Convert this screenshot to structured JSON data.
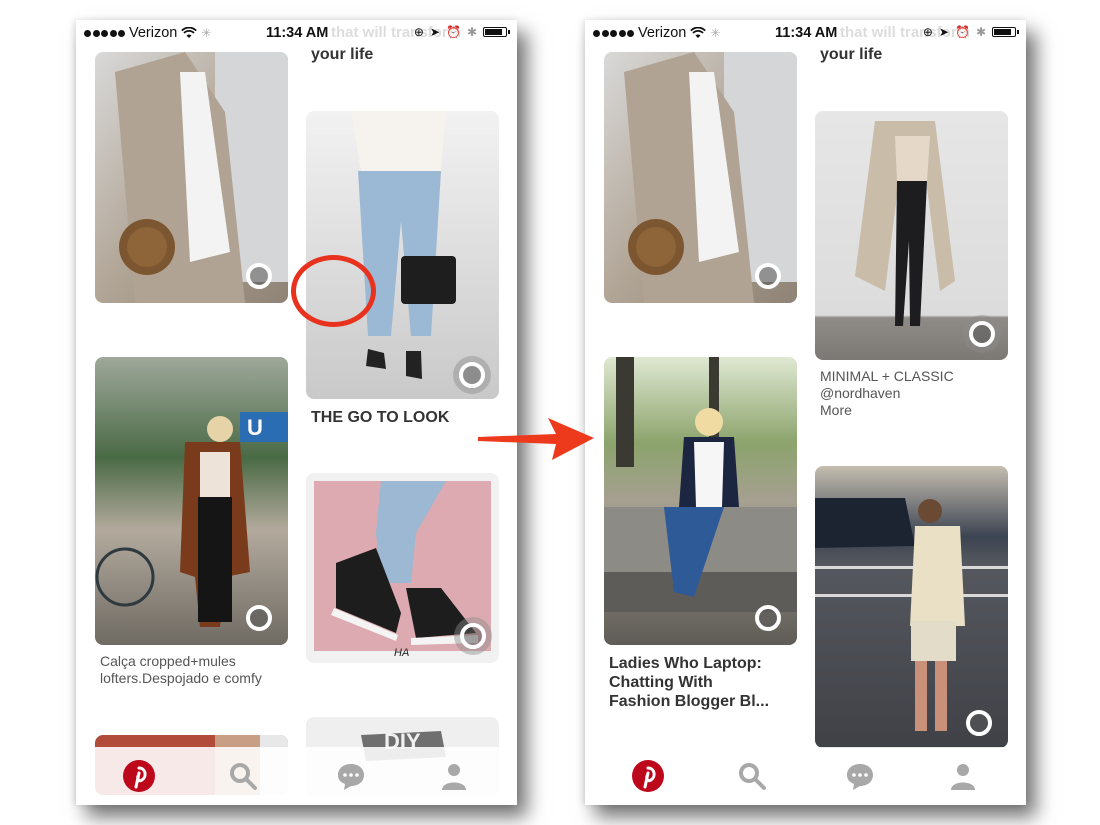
{
  "annotation": {
    "arrow_color": "#ee3a1c",
    "circle_color": "#e8321e",
    "arrow_direction": "right"
  },
  "colors": {
    "pinterest_red": "#bd081c",
    "nav_gray": "#a8a8a8",
    "text_dark": "#333333",
    "text_caption": "#555555"
  },
  "screens": [
    {
      "status_bar": {
        "carrier": "Verizon",
        "signal_dots": 5,
        "time": "11:34 AM",
        "ghost_text": "that will transform"
      },
      "heading_fragment": "your life",
      "pins": [
        {
          "id": "pin-blazer-bag",
          "caption": "",
          "title": ""
        },
        {
          "id": "pin-jeans-slides",
          "caption": "",
          "title": "THE GO TO LOOK"
        },
        {
          "id": "pin-subway-coat",
          "caption": "Calça cropped+mules lofters.Despojado e comfy",
          "title": ""
        },
        {
          "id": "pin-sneakers-illustration",
          "caption": "",
          "title": "",
          "signature": "HA"
        },
        {
          "id": "pin-red-partial",
          "caption": "",
          "title": ""
        },
        {
          "id": "pin-diy-partial",
          "caption": "",
          "title": "",
          "badge": "DIY"
        }
      ],
      "nav": [
        {
          "icon": "pinterest-logo-icon",
          "label": "Home"
        },
        {
          "icon": "search-icon",
          "label": "Search"
        },
        {
          "icon": "chat-bubble-icon",
          "label": "Notifications"
        },
        {
          "icon": "profile-icon",
          "label": "Profile"
        }
      ]
    },
    {
      "status_bar": {
        "carrier": "Verizon",
        "signal_dots": 5,
        "time": "11:34 AM",
        "ghost_text": "that will transform"
      },
      "heading_fragment": "your life",
      "pins": [
        {
          "id": "pin-blazer-bag",
          "caption": "",
          "title": ""
        },
        {
          "id": "pin-long-coat",
          "caption": "MINIMAL + CLASSIC\n@nordhaven\nMore",
          "caption_lines": [
            "MINIMAL + CLASSIC",
            "@nordhaven",
            "More"
          ],
          "title": ""
        },
        {
          "id": "pin-bench-blonde",
          "caption": "",
          "title": "Ladies Who Laptop: Chatting With Fashion Blogger Bl...",
          "title_lines": [
            "Ladies Who Laptop:",
            "Chatting With",
            "Fashion Blogger Bl..."
          ]
        },
        {
          "id": "pin-street-cream",
          "caption": "",
          "title": ""
        }
      ],
      "nav": [
        {
          "icon": "pinterest-logo-icon",
          "label": "Home"
        },
        {
          "icon": "search-icon",
          "label": "Search"
        },
        {
          "icon": "chat-bubble-icon",
          "label": "Notifications"
        },
        {
          "icon": "profile-icon",
          "label": "Profile"
        }
      ]
    }
  ]
}
